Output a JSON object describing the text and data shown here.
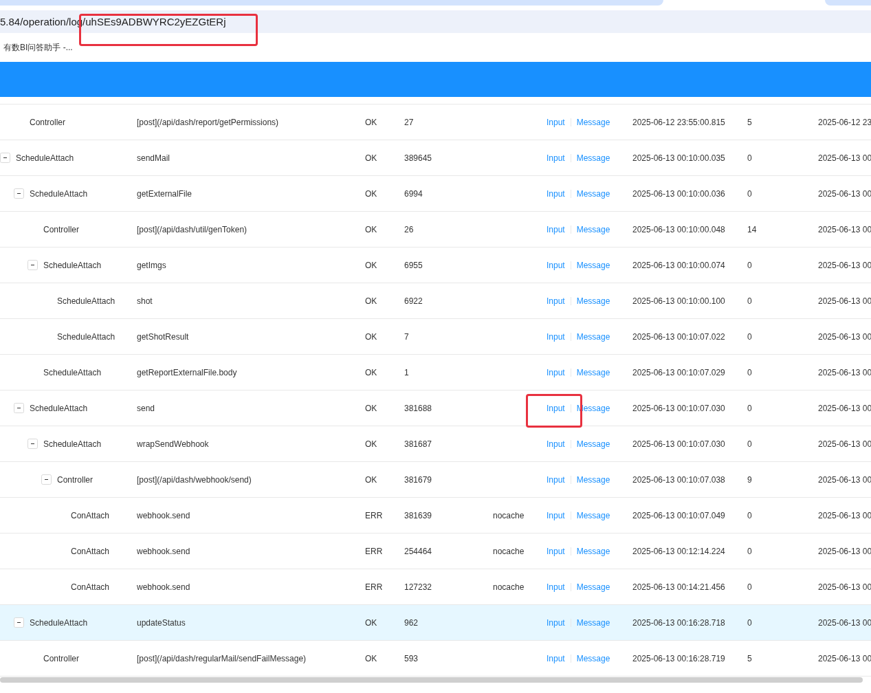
{
  "browser": {
    "address": "5.84/operation/log/uhSEs9ADBWYRC2yEZGtERj",
    "bookmarks": [
      "有数BI问答助手 -..."
    ]
  },
  "tree": [
    {
      "children": [
        {
          "type": "Controller",
          "method": "[post](/api/dash/report/getPermissions)",
          "status": "OK",
          "duration": "27",
          "actions": [
            "Input",
            "Message"
          ],
          "start": "2025-06-12 23:55:00.815",
          "count": "5",
          "end": "2025-06-12 23",
          "selected": false
        }
      ]
    },
    {
      "type": "ScheduleAttach",
      "method": "sendMail",
      "status": "OK",
      "duration": "389645",
      "actions": [
        "Input",
        "Message"
      ],
      "start": "2025-06-13 00:10:00.035",
      "count": "0",
      "end": "2025-06-13 00",
      "selected": false,
      "expanded": true,
      "children": [
        {
          "type": "ScheduleAttach",
          "method": "getExternalFile",
          "status": "OK",
          "duration": "6994",
          "actions": [
            "Input",
            "Message"
          ],
          "start": "2025-06-13 00:10:00.036",
          "count": "0",
          "end": "2025-06-13 00",
          "selected": false,
          "expanded": true,
          "children": [
            {
              "type": "Controller",
              "method": "[post](/api/dash/util/genToken)",
              "status": "OK",
              "duration": "26",
              "actions": [
                "Input",
                "Message"
              ],
              "start": "2025-06-13 00:10:00.048",
              "count": "14",
              "end": "2025-06-13 00",
              "selected": false
            },
            {
              "type": "ScheduleAttach",
              "method": "getImgs",
              "status": "OK",
              "duration": "6955",
              "actions": [
                "Input",
                "Message"
              ],
              "start": "2025-06-13 00:10:00.074",
              "count": "0",
              "end": "2025-06-13 00",
              "selected": false,
              "expanded": true,
              "children": [
                {
                  "type": "ScheduleAttach",
                  "method": "shot",
                  "status": "OK",
                  "duration": "6922",
                  "actions": [
                    "Input",
                    "Message"
                  ],
                  "start": "2025-06-13 00:10:00.100",
                  "count": "0",
                  "end": "2025-06-13 00",
                  "selected": false
                },
                {
                  "type": "ScheduleAttach",
                  "method": "getShotResult",
                  "status": "OK",
                  "duration": "7",
                  "actions": [
                    "Input",
                    "Message"
                  ],
                  "start": "2025-06-13 00:10:07.022",
                  "count": "0",
                  "end": "2025-06-13 00",
                  "selected": false
                }
              ]
            },
            {
              "type": "ScheduleAttach",
              "method": "getReportExternalFile.body",
              "status": "OK",
              "duration": "1",
              "actions": [
                "Input",
                "Message"
              ],
              "start": "2025-06-13 00:10:07.029",
              "count": "0",
              "end": "2025-06-13 00",
              "selected": false
            }
          ]
        },
        {
          "type": "ScheduleAttach",
          "method": "send",
          "status": "OK",
          "duration": "381688",
          "actions": [
            "Input",
            "Message"
          ],
          "start": "2025-06-13 00:10:07.030",
          "count": "0",
          "end": "2025-06-13 00",
          "selected": false,
          "expanded": true,
          "children": [
            {
              "type": "ScheduleAttach",
              "method": "wrapSendWebhook",
              "status": "OK",
              "duration": "381687",
              "actions": [
                "Input",
                "Message"
              ],
              "start": "2025-06-13 00:10:07.030",
              "count": "0",
              "end": "2025-06-13 00",
              "selected": false,
              "expanded": true,
              "children": [
                {
                  "type": "Controller",
                  "method": "[post](/api/dash/webhook/send)",
                  "status": "OK",
                  "duration": "381679",
                  "actions": [
                    "Input",
                    "Message"
                  ],
                  "start": "2025-06-13 00:10:07.038",
                  "count": "9",
                  "end": "2025-06-13 00",
                  "selected": false,
                  "expanded": true,
                  "children": [
                    {
                      "type": "ConAttach",
                      "method": "webhook.send",
                      "status": "ERR",
                      "duration": "381639",
                      "cache": "nocache",
                      "actions": [
                        "Input",
                        "Message"
                      ],
                      "start": "2025-06-13 00:10:07.049",
                      "count": "0",
                      "end": "2025-06-13 00",
                      "selected": false
                    },
                    {
                      "type": "ConAttach",
                      "method": "webhook.send",
                      "status": "ERR",
                      "duration": "254464",
                      "cache": "nocache",
                      "actions": [
                        "Input",
                        "Message"
                      ],
                      "start": "2025-06-13 00:12:14.224",
                      "count": "0",
                      "end": "2025-06-13 00",
                      "selected": false
                    },
                    {
                      "type": "ConAttach",
                      "method": "webhook.send",
                      "status": "ERR",
                      "duration": "127232",
                      "cache": "nocache",
                      "actions": [
                        "Input",
                        "Message"
                      ],
                      "start": "2025-06-13 00:14:21.456",
                      "count": "0",
                      "end": "2025-06-13 00",
                      "selected": false
                    }
                  ]
                }
              ]
            }
          ]
        },
        {
          "type": "ScheduleAttach",
          "method": "updateStatus",
          "status": "OK",
          "duration": "962",
          "actions": [
            "Input",
            "Message"
          ],
          "start": "2025-06-13 00:16:28.718",
          "count": "0",
          "end": "2025-06-13 00",
          "selected": true,
          "expanded": true,
          "children": [
            {
              "type": "Controller",
              "method": "[post](/api/dash/regularMail/sendFailMessage)",
              "status": "OK",
              "duration": "593",
              "actions": [
                "Input",
                "Message"
              ],
              "start": "2025-06-13 00:16:28.719",
              "count": "5",
              "end": "2025-06-13 00",
              "selected": false
            }
          ]
        }
      ]
    }
  ]
}
